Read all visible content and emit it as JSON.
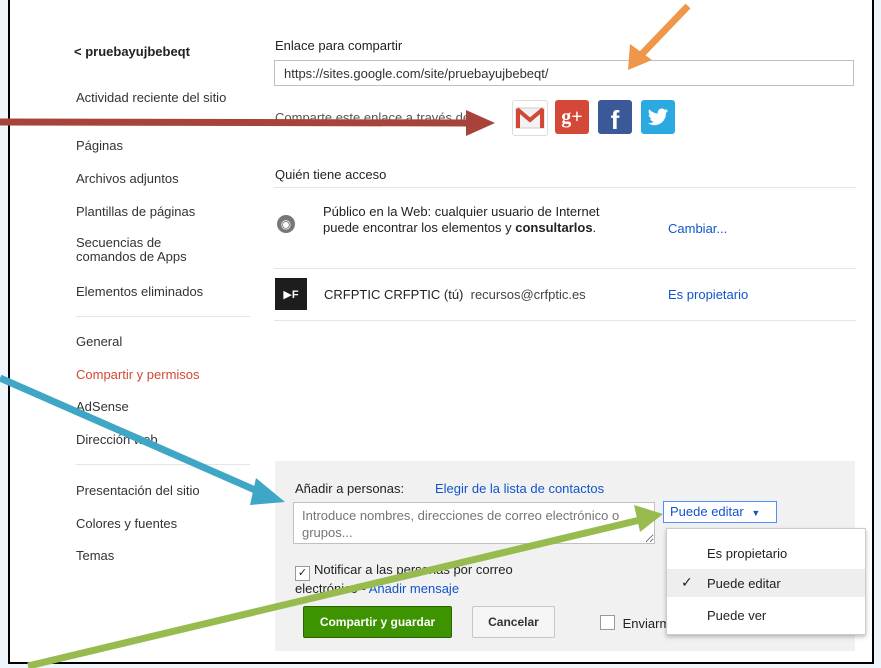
{
  "sidebar": {
    "back_label": "pruebayujbebeqt",
    "items": [
      {
        "label": "Actividad reciente del sitio"
      },
      {
        "label": "Páginas"
      },
      {
        "label": "Archivos adjuntos"
      },
      {
        "label": "Plantillas de páginas"
      },
      {
        "label": "Secuencias de comandos de Apps"
      },
      {
        "label": "Elementos eliminados"
      },
      {
        "label": "General"
      },
      {
        "label": "Compartir y permisos"
      },
      {
        "label": "AdSense"
      },
      {
        "label": "Dirección web"
      },
      {
        "label": "Presentación del sitio"
      },
      {
        "label": "Colores y fuentes"
      },
      {
        "label": "Temas"
      }
    ],
    "active_item": "Compartir y permisos"
  },
  "share": {
    "link_label": "Enlace para compartir",
    "url": "https://sites.google.com/site/pruebayujbebeqt/",
    "via_label": "Comparte este enlace a través de:",
    "services": [
      "gmail-icon",
      "google-plus-icon",
      "facebook-icon",
      "twitter-icon"
    ]
  },
  "access": {
    "heading": "Quién tiene acceso",
    "public_text": "Público en la Web: cualquier usuario de Internet puede encontrar los elementos y",
    "public_bold": "consultarlos",
    "public_end": ".",
    "change_link": "Cambiar...",
    "owner_name": "CRFPTIC CRFPTIC (tú)",
    "owner_email": "recursos@crfptic.es",
    "owner_role": "Es propietario",
    "owner_avatar_text": "▶F"
  },
  "add_people": {
    "label": "Añadir a personas:",
    "contacts_link": "Elegir de la lista de contactos",
    "input_placeholder": "Introduce nombres, direcciones de correo electrónico o grupos...",
    "permission_value": "Puede editar",
    "notify_text": "Notificar a las personas por correo electrónico -",
    "add_message_link": "Añadir mensaje",
    "notify_checked": true,
    "share_button": "Compartir y guardar",
    "cancel_button": "Cancelar",
    "send_copy_label": "Enviarm"
  },
  "permission_menu": {
    "options": [
      "Es propietario",
      "Puede editar",
      "Puede ver"
    ],
    "selected": "Puede editar"
  },
  "colors": {
    "primary_green": "#3d9400",
    "link_blue": "#1155cc",
    "active_red": "#d14836",
    "arrow_red": "#a8433b",
    "arrow_orange": "#f0964a",
    "arrow_teal": "#3fa7c5",
    "arrow_green": "#98bb4f"
  }
}
